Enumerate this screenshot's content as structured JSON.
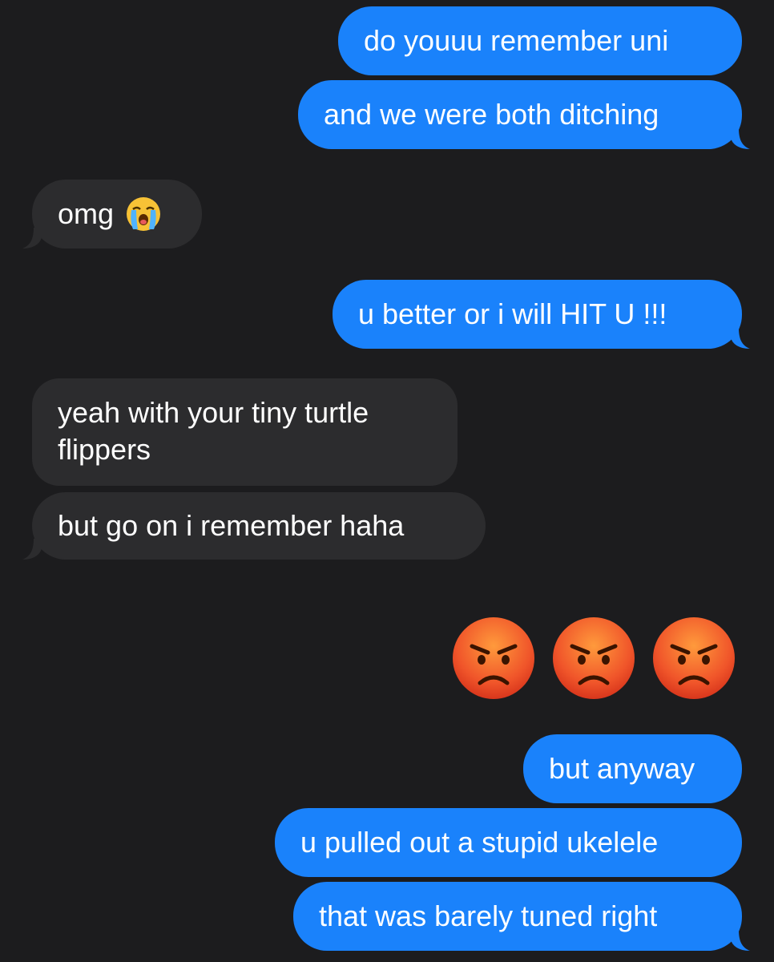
{
  "messages": [
    {
      "id": "m1",
      "direction": "outgoing",
      "text": "do youuu remember uni"
    },
    {
      "id": "m2",
      "direction": "outgoing",
      "text": "and we were both ditching"
    },
    {
      "id": "m3",
      "direction": "incoming",
      "text": "omg",
      "emoji": "loudly-crying-face"
    },
    {
      "id": "m4",
      "direction": "outgoing",
      "text": "u better or i will HIT U !!!"
    },
    {
      "id": "m5",
      "direction": "incoming",
      "text_lines": [
        "yeah with your tiny turtle",
        "flippers"
      ]
    },
    {
      "id": "m6",
      "direction": "incoming",
      "text": "but go on i remember haha"
    },
    {
      "id": "m7",
      "direction": "outgoing",
      "emoji_only": [
        "pouting-face",
        "pouting-face",
        "pouting-face"
      ]
    },
    {
      "id": "m8",
      "direction": "outgoing",
      "text": "but anyway"
    },
    {
      "id": "m9",
      "direction": "outgoing",
      "text": "u pulled out a stupid ukelele"
    },
    {
      "id": "m10",
      "direction": "outgoing",
      "text": "that was barely tuned right"
    }
  ],
  "colors": {
    "background": "#1c1c1e",
    "outgoing_bubble": "#1a82fb",
    "incoming_bubble": "#2c2c2e",
    "text": "#ffffff"
  }
}
